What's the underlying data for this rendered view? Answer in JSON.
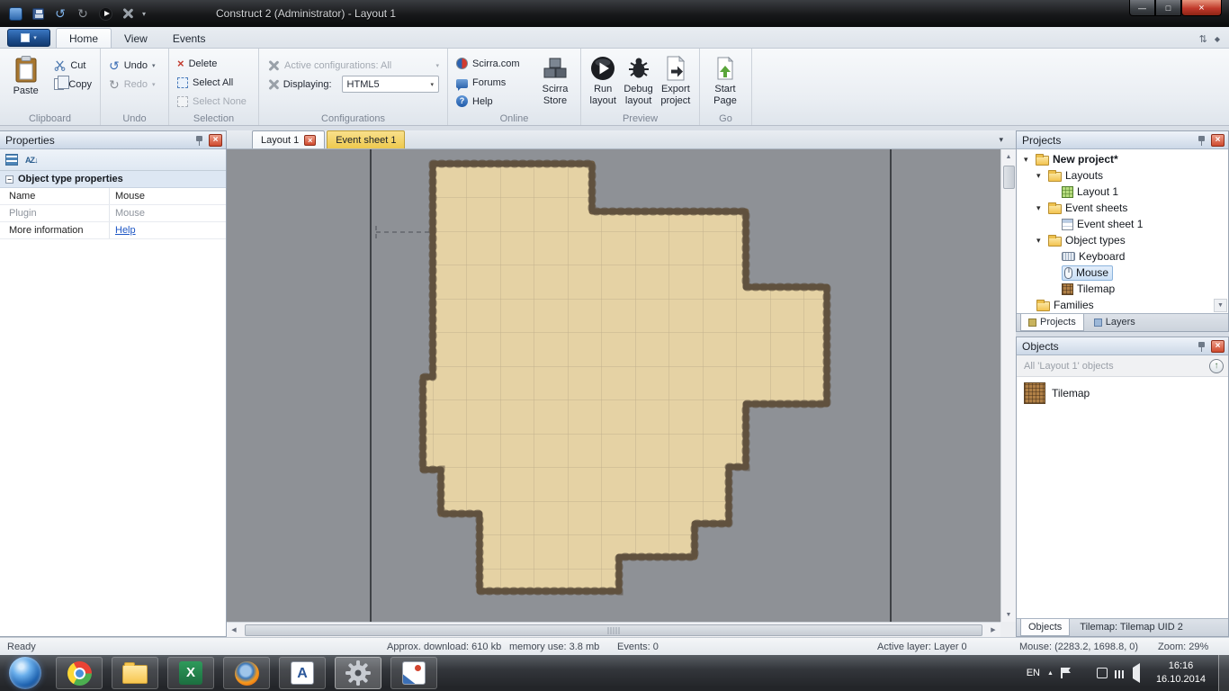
{
  "colors": {
    "accent_blue": "#2f6fb4",
    "event_tab_yellow": "#eec94e",
    "selection_blue": "#cbe0f6",
    "canvas_gray": "#8e9196",
    "tilemap_fill": "#e5d2a4",
    "tilemap_border": "#6e5c44",
    "close_red": "#cf4a2e"
  },
  "icons": {
    "dropdown_arrow": "▾",
    "close_x": "×",
    "undo_arrow": "↺",
    "redo_arrow": "↻",
    "minimize": "—",
    "restore": "□",
    "collapse_ribbon": "⇅",
    "diamond": "◆",
    "scroll_up": "▲",
    "scroll_down": "▼",
    "scroll_left": "◀",
    "scroll_right": "▶",
    "expander_open": "▾",
    "minus": "−",
    "up_arrow": "↑",
    "sort_az": "AZ↓",
    "tray_up": "▲"
  },
  "titlebar": {
    "title": "Construct 2 (Administrator) - Layout 1"
  },
  "ribbon": {
    "tabs": [
      {
        "label": "Home"
      },
      {
        "label": "View"
      },
      {
        "label": "Events"
      }
    ],
    "clipboard": {
      "group": "Clipboard",
      "paste": "Paste",
      "cut": "Cut",
      "copy": "Copy"
    },
    "undo": {
      "group": "Undo",
      "undo": "Undo",
      "redo": "Redo"
    },
    "selection": {
      "group": "Selection",
      "delete": "Delete",
      "select_all": "Select All",
      "select_none": "Select None"
    },
    "configurations": {
      "group": "Configurations",
      "active_configurations": "Active configurations: All",
      "displaying": "Displaying:",
      "displaying_value": "HTML5"
    },
    "online": {
      "group": "Online",
      "scirra": "Scirra.com",
      "forums": "Forums",
      "help": "Help",
      "store": "Scirra Store"
    },
    "preview": {
      "group": "Preview",
      "run": "Run layout",
      "debug": "Debug layout",
      "export": "Export project"
    },
    "go": {
      "group": "Go",
      "start": "Start Page"
    }
  },
  "properties": {
    "title": "Properties",
    "section": "Object type properties",
    "rows": [
      {
        "key": "Name",
        "value": "Mouse"
      },
      {
        "key": "Plugin",
        "value": "Mouse"
      }
    ],
    "more_information": "More information",
    "help_link": "Help"
  },
  "editor": {
    "tabs": [
      {
        "label": "Layout 1"
      },
      {
        "label": "Event sheet 1"
      }
    ]
  },
  "projects_panel": {
    "title": "Projects",
    "tree": [
      {
        "label": "New project*",
        "icon": "folder-icon"
      },
      {
        "label": "Layouts",
        "icon": "folder-icon"
      },
      {
        "label": "Layout 1",
        "icon": "layout-icon"
      },
      {
        "label": "Event sheets",
        "icon": "folder-icon"
      },
      {
        "label": "Event sheet 1",
        "icon": "event-sheet-icon"
      },
      {
        "label": "Object types",
        "icon": "folder-icon"
      },
      {
        "label": "Keyboard",
        "icon": "keyboard-icon"
      },
      {
        "label": "Mouse",
        "icon": "mouse-icon"
      },
      {
        "label": "Tilemap",
        "icon": "tilemap-icon"
      },
      {
        "label": "Families",
        "icon": "folder-icon"
      }
    ],
    "tabs": [
      {
        "label": "Projects"
      },
      {
        "label": "Layers"
      }
    ]
  },
  "objects_panel": {
    "title": "Objects",
    "filter": "All 'Layout 1' objects",
    "items": [
      {
        "label": "Tilemap",
        "icon": "tilemap-icon"
      }
    ],
    "tabs": [
      {
        "label": "Objects"
      },
      {
        "label": "Tilemap: Tilemap UID 2"
      }
    ]
  },
  "statusbar": {
    "ready": "Ready",
    "download": "Approx. download: 610 kb",
    "memory": "memory use: 3.8 mb",
    "events": "Events: 0",
    "active_layer": "Active layer: Layer 0",
    "mouse": "Mouse: (2283.2, 1698.8, 0)",
    "zoom": "Zoom: 29%"
  },
  "taskbar": {
    "language": "EN",
    "time": "16:16",
    "date": "16.10.2014"
  }
}
